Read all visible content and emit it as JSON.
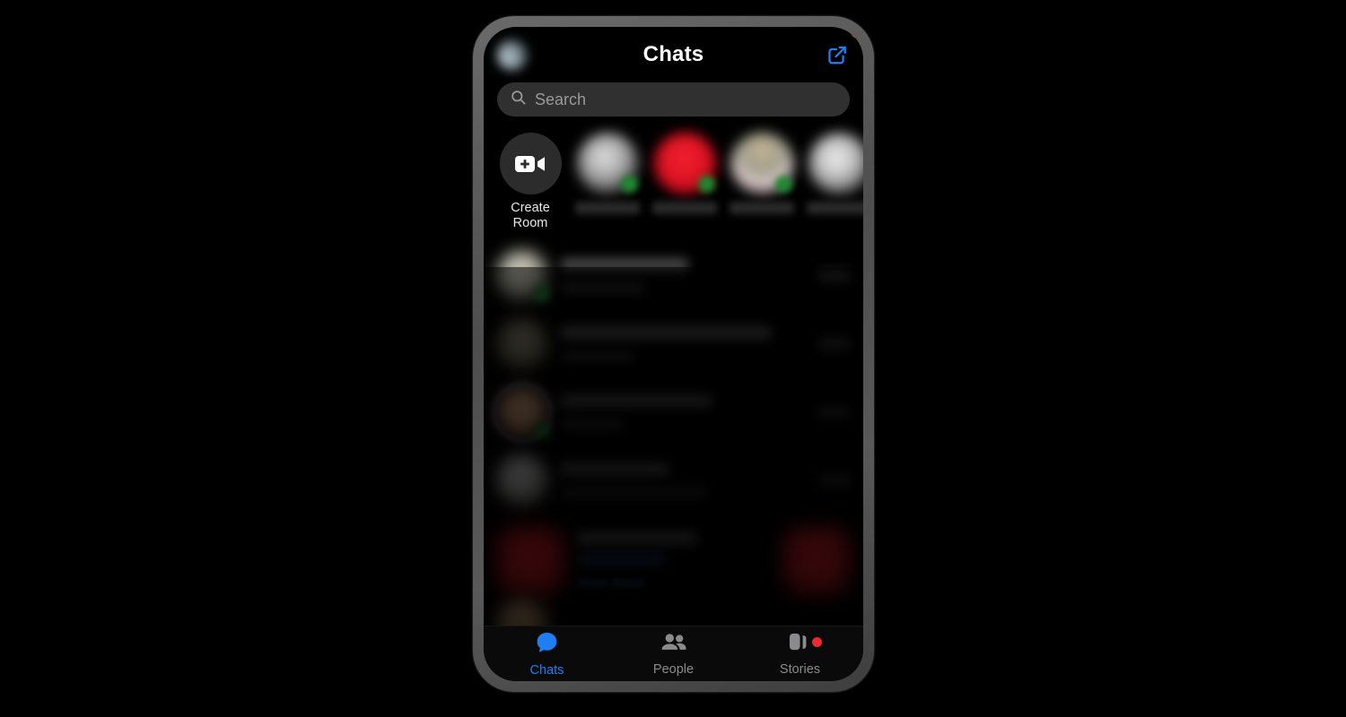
{
  "app": {
    "header": {
      "title": "Chats",
      "profile_avatar_name": "profile-avatar",
      "profile_badge": "",
      "compose_icon": "compose-icon"
    },
    "search": {
      "placeholder": "Search",
      "value": "",
      "icon": "search-icon"
    },
    "rooms_row": {
      "create_room": {
        "label_line1": "Create",
        "label_line2": "Room",
        "icon": "video-plus-icon"
      },
      "active_contacts": [
        {
          "name": "",
          "avatar_color": "#9d9d9d",
          "online": true
        },
        {
          "name": "",
          "avatar_color": "#d81020",
          "online": true
        },
        {
          "name": "",
          "avatar_color": "#b9a68f",
          "online": true
        },
        {
          "name": "",
          "avatar_color": "#cfcfcf",
          "online": false
        }
      ]
    },
    "chat_list": [
      {
        "name": "",
        "snippet": "",
        "time": "",
        "avatar_color": "#a8a89a",
        "online": true,
        "ring": false
      },
      {
        "name": "",
        "snippet": "",
        "time": "",
        "avatar_color": "#6b6450",
        "online": false,
        "ring": false
      },
      {
        "name": "",
        "snippet": "",
        "time": "",
        "avatar_color": "#c08a66",
        "online": true,
        "ring": true
      },
      {
        "name": "",
        "snippet": "",
        "time": "",
        "avatar_color": "#b5b5b5",
        "online": false,
        "ring": false
      }
    ],
    "promo": {
      "title": "",
      "subtitle": "",
      "link_label": "View more"
    },
    "tabs": [
      {
        "label": "Chats",
        "icon": "chat-bubble-icon",
        "active": true,
        "badge": false
      },
      {
        "label": "People",
        "icon": "people-icon",
        "active": false,
        "badge": false
      },
      {
        "label": "Stories",
        "icon": "stories-icon",
        "active": false,
        "badge": true
      }
    ]
  },
  "colors": {
    "accent": "#1f7ff2",
    "badge": "#ea2a33",
    "online": "#1f8a32",
    "screen_bg": "#000000",
    "search_bg": "#303030"
  }
}
